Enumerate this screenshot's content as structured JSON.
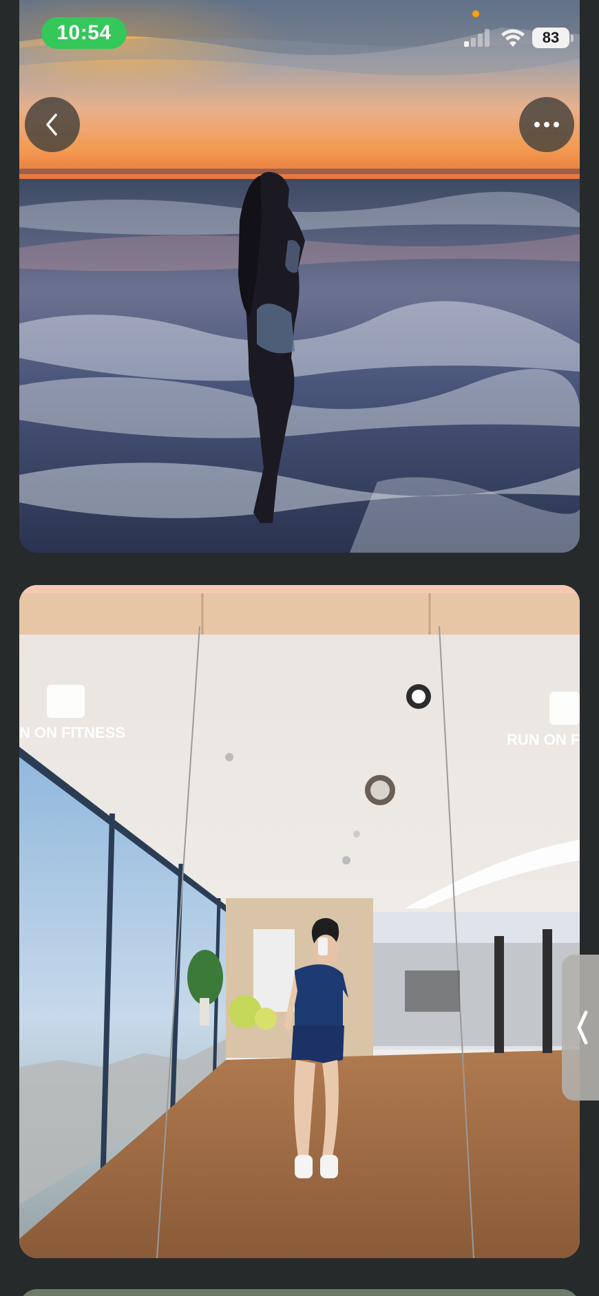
{
  "status_bar": {
    "time": "10:54",
    "battery": "83",
    "signal_icon": "cellular-signal-icon",
    "wifi_icon": "wifi-icon"
  },
  "navigation": {
    "back_icon": "chevron-left-icon",
    "more_icon": "ellipsis-icon",
    "side_handle_icon": "chevron-left-icon"
  },
  "photos": [
    {
      "scene": "beach-sunset-photo"
    },
    {
      "scene": "gym-mirror-selfie-photo",
      "wall_signage": "RUN ON FITNESS",
      "wall_signage_left": "N ON FITNESS",
      "wall_signage_right": "RUN ON FIT"
    },
    {
      "scene": "photo-partial"
    }
  ],
  "colors": {
    "time_pill": "#34c759",
    "background": "#272a2b",
    "privacy_dot": "#ff9f0a"
  }
}
